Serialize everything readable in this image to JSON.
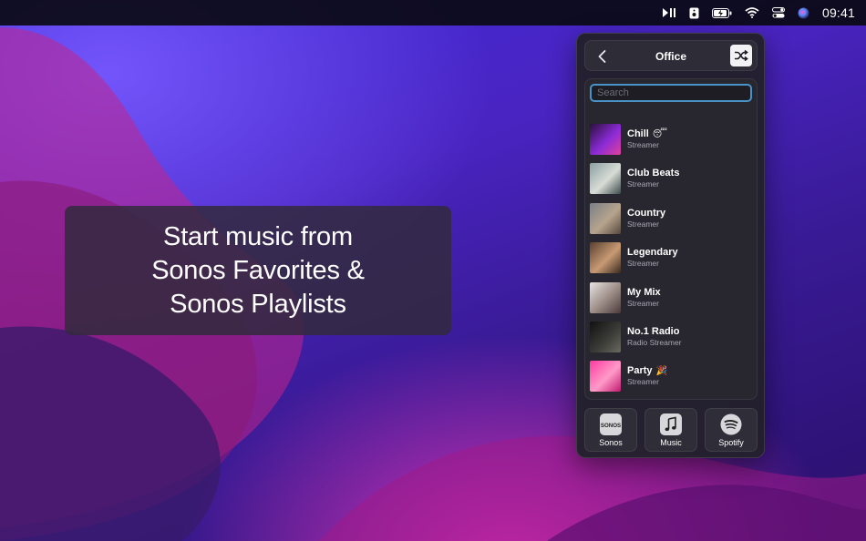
{
  "menubar": {
    "clock": "09:41",
    "icons": [
      "play-pause-icon",
      "sonos-speaker-icon",
      "battery-icon",
      "wifi-icon",
      "control-center-icon",
      "siri-icon"
    ]
  },
  "promo": {
    "line1": "Start music from",
    "line2": "Sonos Favorites &",
    "line3": "Sonos Playlists"
  },
  "panel": {
    "title": "Office",
    "search_placeholder": "Search",
    "items": [
      {
        "title": "Chill",
        "subtitle": "Streamer",
        "emoji": "😴",
        "colors": [
          "#2a0f3a",
          "#8a2bd6",
          "#e0409a"
        ]
      },
      {
        "title": "Club Beats",
        "subtitle": "Streamer",
        "emoji": "",
        "colors": [
          "#8aa0a0",
          "#d8dcd6",
          "#3c4a4c"
        ]
      },
      {
        "title": "Country",
        "subtitle": "Streamer",
        "emoji": "",
        "colors": [
          "#7a7f86",
          "#b7a48e",
          "#54473c"
        ]
      },
      {
        "title": "Legendary",
        "subtitle": "Streamer",
        "emoji": "",
        "colors": [
          "#5a4030",
          "#c89a74",
          "#3a2a20"
        ]
      },
      {
        "title": "My Mix",
        "subtitle": "Streamer",
        "emoji": "",
        "colors": [
          "#e8e4e0",
          "#9a8a84",
          "#4a3a3a"
        ]
      },
      {
        "title": "No.1 Radio",
        "subtitle": "Radio Streamer",
        "emoji": "",
        "colors": [
          "#111111",
          "#3a3a36",
          "#6a6a60"
        ]
      },
      {
        "title": "Party",
        "subtitle": "Streamer",
        "emoji": "🎉",
        "colors": [
          "#ff3aa0",
          "#ff9ac8",
          "#c01a70"
        ]
      }
    ],
    "sources": [
      {
        "label": "Sonos",
        "icon": "sonos-logo-icon",
        "logo_text": "SONOS"
      },
      {
        "label": "Music",
        "icon": "music-note-icon"
      },
      {
        "label": "Spotify",
        "icon": "spotify-icon"
      }
    ]
  },
  "colors": {
    "accent": "#4a93c8",
    "panel_bg": "#22202c",
    "text_secondary": "#a8a7b2"
  }
}
